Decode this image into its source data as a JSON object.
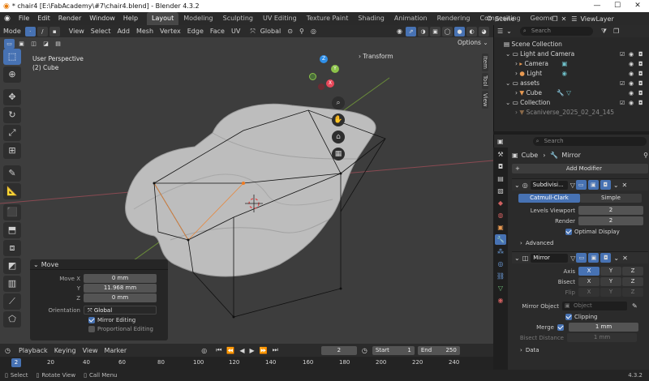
{
  "window": {
    "title": "* chair4 [E:\\FabAcademy\\#7\\chair4.blend] - Blender 4.3.2",
    "minimize": "—",
    "maximize": "☐",
    "close": "✕"
  },
  "menubar": {
    "items": [
      "File",
      "Edit",
      "Render",
      "Window",
      "Help"
    ],
    "workspaces": [
      "Layout",
      "Modeling",
      "Sculpting",
      "UV Editing",
      "Texture Paint",
      "Shading",
      "Animation",
      "Rendering",
      "Compositing",
      "Geome"
    ],
    "active_workspace": "Layout",
    "scene_label": "Scene",
    "viewlayer_label": "ViewLayer"
  },
  "viewport_header": {
    "mode": "Mode",
    "menus": [
      "View",
      "Select",
      "Add",
      "Mesh",
      "Vertex",
      "Edge",
      "Face",
      "UV"
    ],
    "transform_orientation": "Global",
    "options": "Options"
  },
  "viewport": {
    "view_name": "User Perspective",
    "object_name": "(2) Cube",
    "transform_tab": "Transform",
    "side_tabs": [
      "Item",
      "Tool",
      "View"
    ],
    "gizmo": {
      "z": "Z",
      "y": "Y",
      "x": "X"
    }
  },
  "operator_panel": {
    "title": "Move",
    "move_x_label": "Move X",
    "move_x": "0 mm",
    "y_label": "Y",
    "y": "11.968 mm",
    "z_label": "Z",
    "z": "0 mm",
    "orientation_label": "Orientation",
    "orientation": "Global",
    "mirror_editing": "Mirror Editing",
    "proportional_editing": "Proportional Editing"
  },
  "timeline": {
    "menus": [
      "Playback",
      "Keying",
      "View",
      "Marker"
    ],
    "current_frame": "2",
    "start_label": "Start",
    "start": "1",
    "end_label": "End",
    "end": "250",
    "ruler": [
      "2",
      "20",
      "40",
      "60",
      "80",
      "100",
      "120",
      "140",
      "160",
      "180",
      "200",
      "220",
      "240"
    ]
  },
  "statusbar": {
    "select": "Select",
    "rotate_view": "Rotate View",
    "call_menu": "Call Menu",
    "version": "4.3.2"
  },
  "outliner": {
    "search_placeholder": "Search",
    "rows": [
      {
        "label": "Scene Collection",
        "indent": 0
      },
      {
        "label": "Light and Camera",
        "indent": 1
      },
      {
        "label": "Camera",
        "indent": 2
      },
      {
        "label": "Light",
        "indent": 2
      },
      {
        "label": "assets",
        "indent": 1
      },
      {
        "label": "Cube",
        "indent": 2
      },
      {
        "label": "Collection",
        "indent": 1
      },
      {
        "label": "Scaniverse_2025_02_24_145",
        "indent": 2
      }
    ]
  },
  "properties": {
    "search_placeholder": "Search",
    "breadcrumb_object": "Cube",
    "breadcrumb_modifier": "Mirror",
    "add_modifier": "Add Modifier",
    "subdivision": {
      "name": "Subdivisi...",
      "catmull": "Catmull-Clark",
      "simple": "Simple",
      "levels_viewport_label": "Levels Viewport",
      "levels_viewport": "2",
      "render_label": "Render",
      "render": "2",
      "optimal_display": "Optimal Display",
      "advanced": "Advanced"
    },
    "mirror": {
      "name": "Mirror",
      "axis_label": "Axis",
      "bisect_label": "Bisect",
      "flip_label": "Flip",
      "x": "X",
      "y": "Y",
      "z": "Z",
      "mirror_object_label": "Mirror Object",
      "mirror_object_placeholder": "Object",
      "clipping": "Clipping",
      "merge_label": "Merge",
      "merge": "1 mm",
      "bisect_distance_label": "Bisect Distance",
      "bisect_distance": "1 mm",
      "data": "Data"
    }
  },
  "colors": {
    "accent_blue": "#4772b3",
    "axis_x": "#e8485a",
    "axis_y": "#8cc24a",
    "axis_z": "#2f8fe8"
  }
}
